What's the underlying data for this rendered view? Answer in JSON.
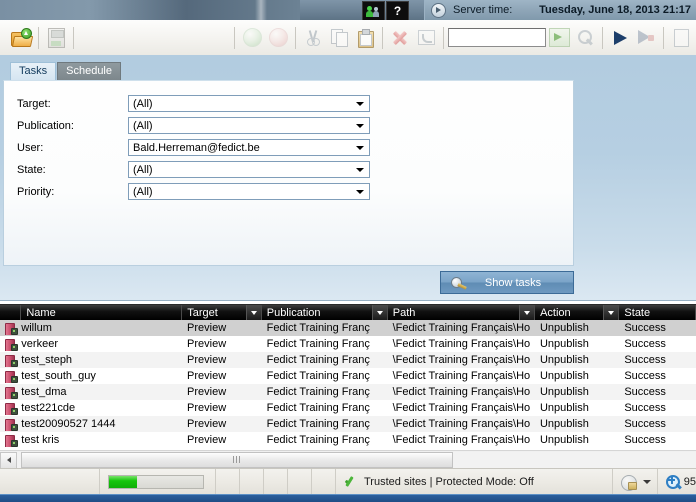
{
  "window": {
    "server_time_label": "Server time:",
    "server_time_value": "Tuesday, June 18, 2013 21:17",
    "mini_help_label": "?"
  },
  "toolbar": {
    "search_value": "",
    "search_placeholder": ""
  },
  "tabs": [
    {
      "label": "Tasks",
      "active": true
    },
    {
      "label": "Schedule",
      "active": false
    }
  ],
  "filters": [
    {
      "label": "Target:",
      "value": "(All)"
    },
    {
      "label": "Publication:",
      "value": "(All)"
    },
    {
      "label": "User:",
      "value": "Bald.Herreman@fedict.be"
    },
    {
      "label": "State:",
      "value": "(All)"
    },
    {
      "label": "Priority:",
      "value": "(All)"
    }
  ],
  "actions": {
    "show_tasks_label": "Show tasks"
  },
  "grid": {
    "columns": [
      {
        "label": "Name",
        "filter": false
      },
      {
        "label": "Target",
        "filter": true
      },
      {
        "label": "Publication",
        "filter": true
      },
      {
        "label": "Path",
        "filter": true
      },
      {
        "label": "Action",
        "filter": true
      },
      {
        "label": "State",
        "filter": false
      }
    ],
    "rows": [
      {
        "name": "willum",
        "target": "Preview",
        "publication": "Fedict Training Franç",
        "path": "\\Fedict Training Français\\Ho",
        "action": "Unpublish",
        "state": "Success"
      },
      {
        "name": "verkeer",
        "target": "Preview",
        "publication": "Fedict Training Franç",
        "path": "\\Fedict Training Français\\Ho",
        "action": "Unpublish",
        "state": "Success"
      },
      {
        "name": "test_steph",
        "target": "Preview",
        "publication": "Fedict Training Franç",
        "path": "\\Fedict Training Français\\Ho",
        "action": "Unpublish",
        "state": "Success"
      },
      {
        "name": "test_south_guy",
        "target": "Preview",
        "publication": "Fedict Training Franç",
        "path": "\\Fedict Training Français\\Ho",
        "action": "Unpublish",
        "state": "Success"
      },
      {
        "name": "test_dma",
        "target": "Preview",
        "publication": "Fedict Training Franç",
        "path": "\\Fedict Training Français\\Ho",
        "action": "Unpublish",
        "state": "Success"
      },
      {
        "name": "test221cde",
        "target": "Preview",
        "publication": "Fedict Training Franç",
        "path": "\\Fedict Training Français\\Ho",
        "action": "Unpublish",
        "state": "Success"
      },
      {
        "name": "test20090527 1444",
        "target": "Preview",
        "publication": "Fedict Training Franç",
        "path": "\\Fedict Training Français\\Ho",
        "action": "Unpublish",
        "state": "Success"
      },
      {
        "name": "test kris",
        "target": "Preview",
        "publication": "Fedict Training Franç",
        "path": "\\Fedict Training Français\\Ho",
        "action": "Unpublish",
        "state": "Success"
      }
    ]
  },
  "statusbar": {
    "security_text": "Trusted sites | Protected Mode: Off",
    "zoom_level": "95"
  }
}
